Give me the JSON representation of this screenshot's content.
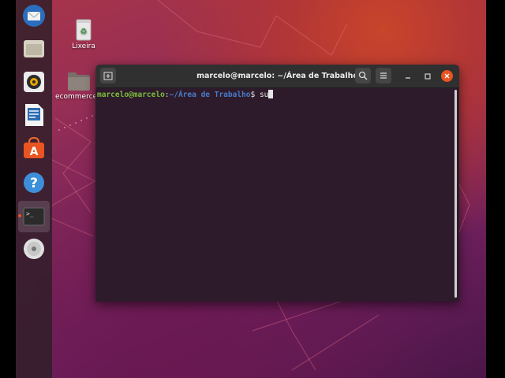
{
  "desktop": {
    "icons": [
      {
        "name": "trash",
        "label": "Lixeira"
      },
      {
        "name": "folder",
        "label": "ecommerce"
      }
    ]
  },
  "dock": {
    "items": [
      {
        "name": "thunderbird-icon"
      },
      {
        "name": "files-icon"
      },
      {
        "name": "rhythmbox-icon"
      },
      {
        "name": "libreoffice-writer-icon"
      },
      {
        "name": "ubuntu-software-icon"
      },
      {
        "name": "help-icon"
      },
      {
        "name": "terminal-icon",
        "active": true
      },
      {
        "name": "dvd-icon"
      }
    ]
  },
  "terminal": {
    "title": "marcelo@marcelo: ~/Área de Trabalho",
    "prompt_user": "marcelo@marcelo",
    "prompt_colon": ":",
    "prompt_path": "~/Área de Trabalho",
    "prompt_symbol": "$ ",
    "command": "su",
    "close_color": "#e95420"
  }
}
